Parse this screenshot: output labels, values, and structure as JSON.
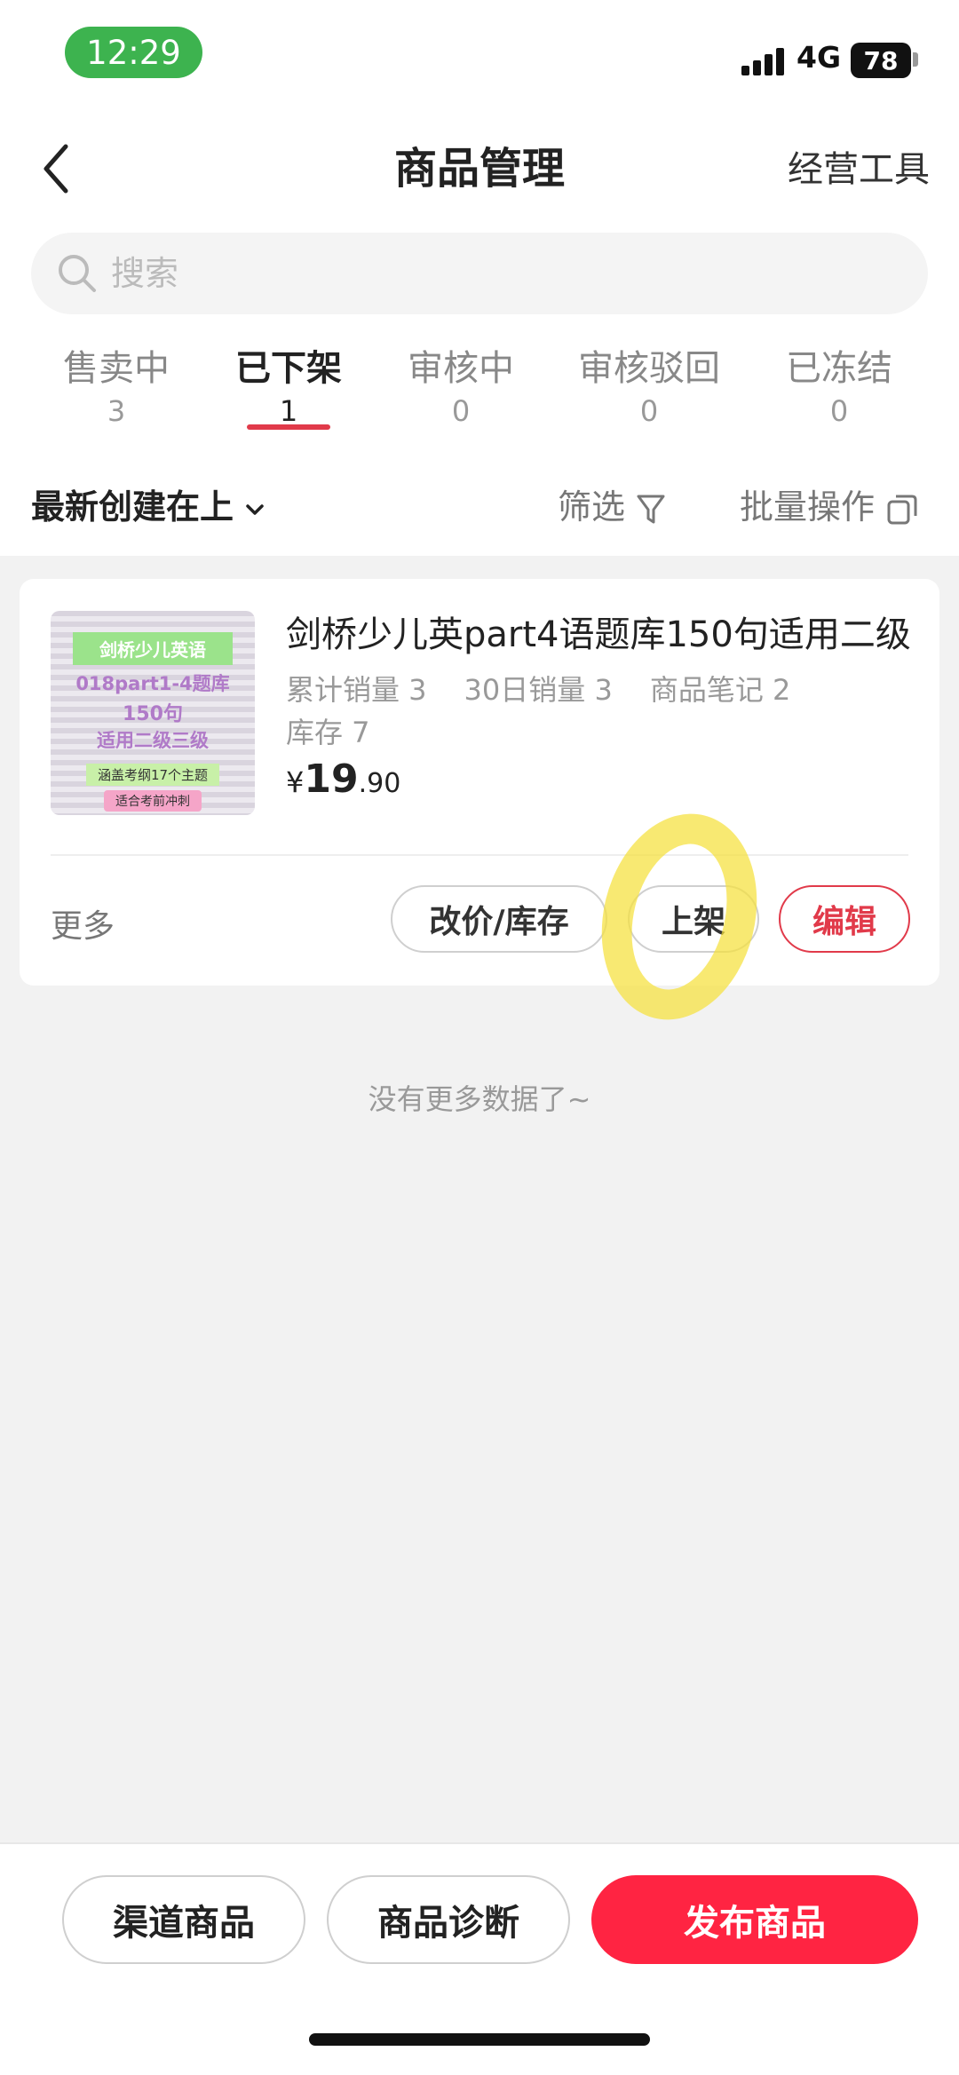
{
  "status_bar": {
    "time": "12:29",
    "network": "4G",
    "battery": "78"
  },
  "header": {
    "title": "商品管理",
    "right_label": "经营工具"
  },
  "search": {
    "placeholder": "搜索"
  },
  "tabs": [
    {
      "label": "售卖中",
      "count": "3"
    },
    {
      "label": "已下架",
      "count": "1",
      "active": true
    },
    {
      "label": "审核中",
      "count": "0"
    },
    {
      "label": "审核驳回",
      "count": "0"
    },
    {
      "label": "已冻结",
      "count": "0"
    }
  ],
  "toolbar": {
    "sort_label": "最新创建在上",
    "filter_label": "筛选",
    "batch_label": "批量操作"
  },
  "product": {
    "title": "剑桥少儿英part4语题库150句适用二级",
    "thumbnail_lines": [
      "剑桥少儿英语",
      "018part1-4题库",
      "150句",
      "适用二级三级",
      "涵盖考纲17个主题",
      "适合考前冲刺"
    ],
    "total_sales": "累计销量 3",
    "sales_30d": "30日销量 3",
    "notes": "商品笔记 2",
    "stock": "库存 7",
    "price_symbol": "¥",
    "price_int": "19",
    "price_dec": ".90",
    "more_label": "更多",
    "btn_price_stock": "改价/库存",
    "btn_list": "上架",
    "btn_edit": "编辑"
  },
  "list_end_text": "没有更多数据了~",
  "bottom": {
    "channel_label": "渠道商品",
    "diagnose_label": "商品诊断",
    "publish_label": "发布商品"
  },
  "colors": {
    "accent_red": "#ff2442",
    "tab_underline": "#e13a4a",
    "time_pill": "#3db34f",
    "highlight": "#f5e13c"
  }
}
